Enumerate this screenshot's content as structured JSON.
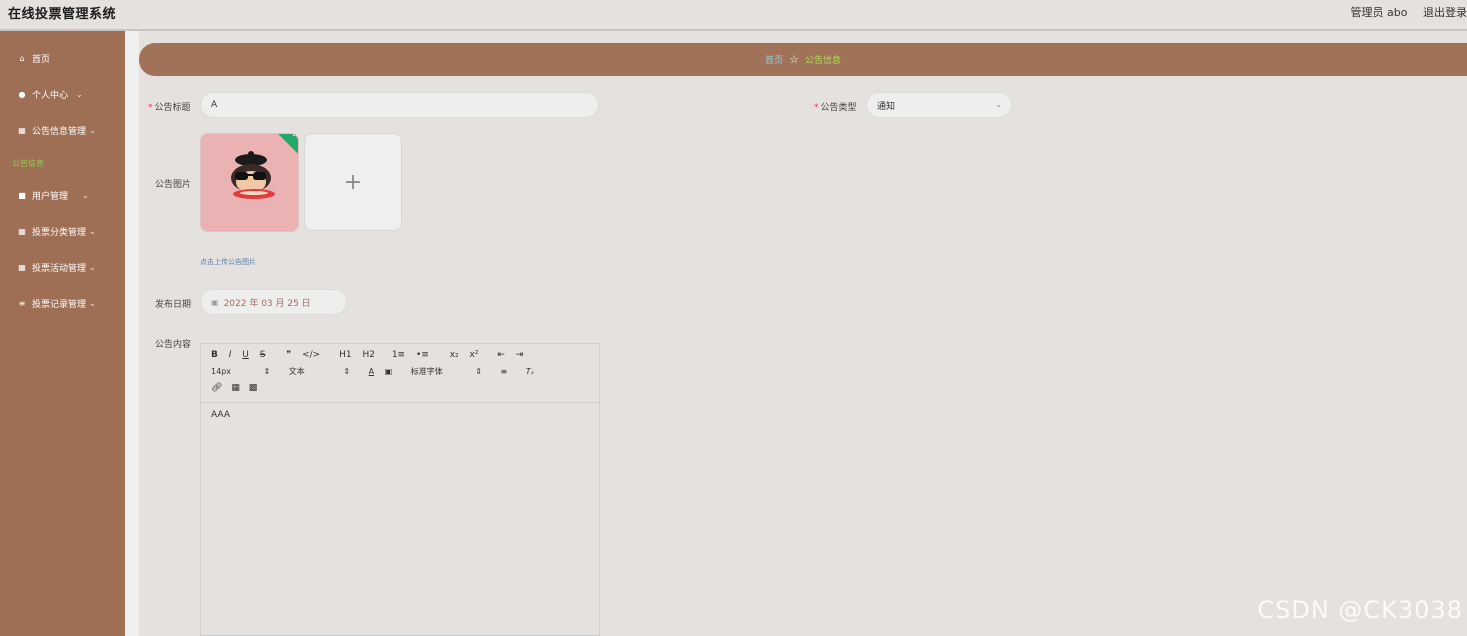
{
  "header": {
    "title": "在线投票管理系统",
    "user_label": "管理员 abo",
    "logout_label": "退出登录"
  },
  "sidebar": {
    "items": [
      {
        "label": "首页"
      },
      {
        "label": "个人中心"
      },
      {
        "label": "公告信息管理"
      },
      {
        "label": "用户管理"
      },
      {
        "label": "投票分类管理"
      },
      {
        "label": "投票活动管理"
      },
      {
        "label": "投票记录管理"
      }
    ],
    "sub_item": "公告信息"
  },
  "breadcrumb": {
    "home": "首页",
    "current": "公告信息"
  },
  "form": {
    "title_label": "公告标题",
    "title_value": "A",
    "type_label": "公告类型",
    "type_value": "通知",
    "image_label": "公告图片",
    "upload_hint": "点击上传公告图片",
    "date_label": "发布日期",
    "date_value": "2022 年 03 月 25 日",
    "content_label": "公告内容"
  },
  "editor": {
    "row1": [
      "B",
      "I",
      "U",
      "S",
      "❞",
      "</>",
      "H1",
      "H2",
      "1≡",
      "•≡",
      "x₂",
      "x²",
      "⇤",
      "⇥"
    ],
    "size_value": "14px",
    "header_value": "文本",
    "font_value": "标准字体",
    "text": "AAA"
  },
  "watermark": "CSDN @CK3038"
}
